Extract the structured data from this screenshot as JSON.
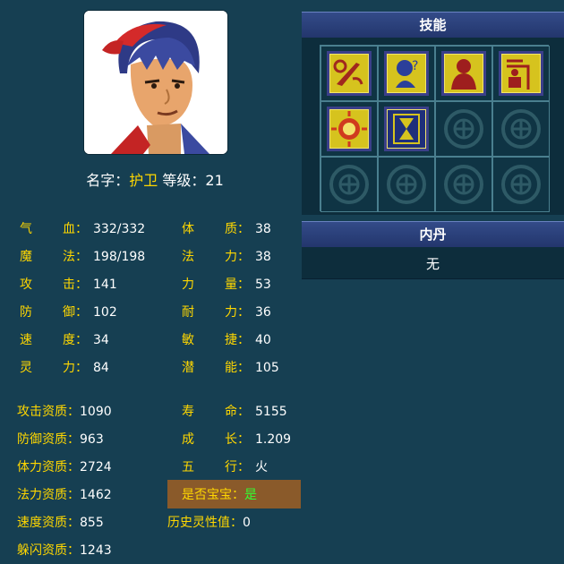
{
  "character": {
    "name_label": "名字：",
    "name": "护卫",
    "level_label": "等级：",
    "level": "21"
  },
  "stats_left": [
    {
      "label_a": "气",
      "label_b": "血：",
      "value": "332/332"
    },
    {
      "label_a": "魔",
      "label_b": "法：",
      "value": "198/198"
    },
    {
      "label_a": "攻",
      "label_b": "击：",
      "value": "141"
    },
    {
      "label_a": "防",
      "label_b": "御：",
      "value": "102"
    },
    {
      "label_a": "速",
      "label_b": "度：",
      "value": "34"
    },
    {
      "label_a": "灵",
      "label_b": "力：",
      "value": "84"
    }
  ],
  "stats_right": [
    {
      "label_a": "体",
      "label_b": "质：",
      "value": "38"
    },
    {
      "label_a": "法",
      "label_b": "力：",
      "value": "38"
    },
    {
      "label_a": "力",
      "label_b": "量：",
      "value": "53"
    },
    {
      "label_a": "耐",
      "label_b": "力：",
      "value": "36"
    },
    {
      "label_a": "敏",
      "label_b": "捷：",
      "value": "40"
    },
    {
      "label_a": "潜",
      "label_b": "能：",
      "value": "105"
    }
  ],
  "aptitudes": [
    {
      "label": "攻击资质：",
      "value": "1090"
    },
    {
      "label": "防御资质：",
      "value": "963"
    },
    {
      "label": "体力资质：",
      "value": "2724"
    },
    {
      "label": "法力资质：",
      "value": "1462"
    },
    {
      "label": "速度资质：",
      "value": "855"
    },
    {
      "label": "躲闪资质：",
      "value": "1243"
    }
  ],
  "attributes": [
    {
      "label_a": "寿",
      "label_b": "命：",
      "value": "5155"
    },
    {
      "label_a": "成",
      "label_b": "长：",
      "value": "1.209"
    },
    {
      "label_a": "五",
      "label_b": "行：",
      "value": "火"
    }
  ],
  "is_baby": {
    "label": "是否宝宝：",
    "value": "是"
  },
  "history": {
    "label": "历史灵性值：",
    "value": "0"
  },
  "skills_panel": {
    "title": "技能",
    "icons": [
      "sword-scroll-icon",
      "magic-orb-icon",
      "warrior-silhouette-icon",
      "fortress-icon",
      "sun-shield-icon",
      "hourglass-icon"
    ],
    "empty_slot_icon": "jade-disc-icon"
  },
  "neidan_panel": {
    "title": "内丹",
    "content": "无"
  },
  "colors": {
    "label": "#ffd700",
    "value": "#ffffff",
    "baby_bg": "#8a5a2a",
    "baby_yes": "#33ff33",
    "background": "#163f52"
  }
}
